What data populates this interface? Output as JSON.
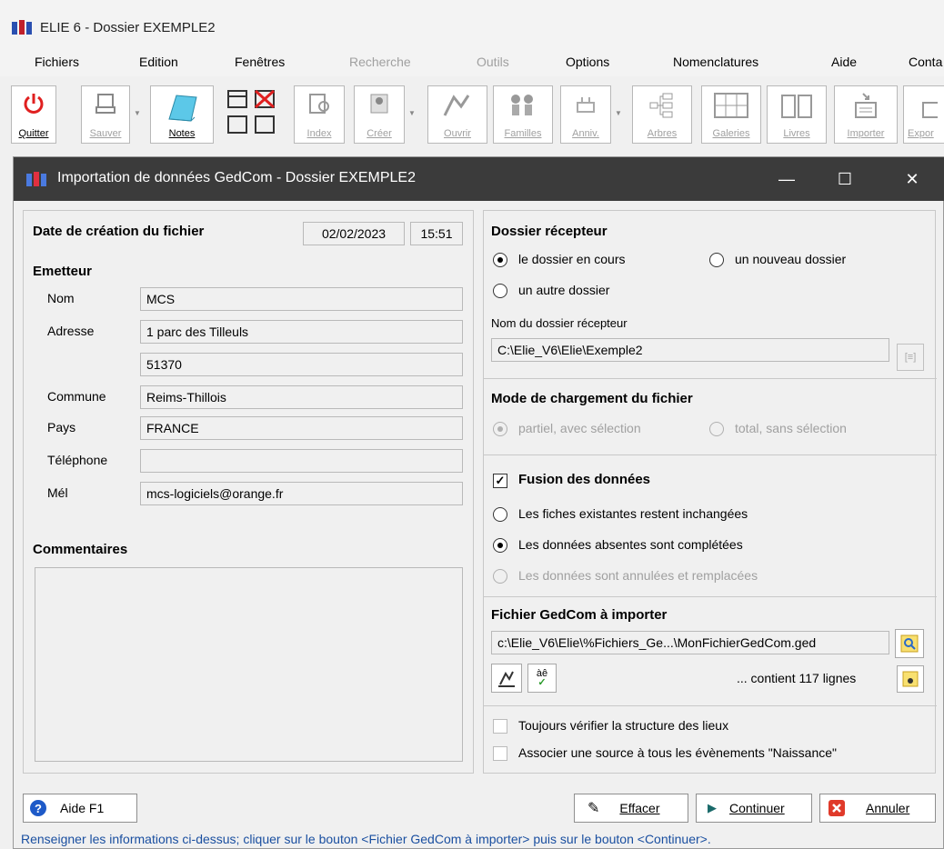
{
  "app": {
    "title": "ELIE 6 - Dossier  EXEMPLE2"
  },
  "menu": {
    "items": [
      {
        "label": "Fichiers"
      },
      {
        "label": "Edition"
      },
      {
        "label": "Fenêtres"
      },
      {
        "label": "Recherche"
      },
      {
        "label": "Outils"
      },
      {
        "label": "Options"
      },
      {
        "label": "Nomenclatures"
      },
      {
        "label": "Aide"
      },
      {
        "label": "Conta"
      }
    ]
  },
  "toolbar": {
    "quitter": "Quitter",
    "sauver": "Sauver",
    "notes": "Notes",
    "index": "Index",
    "creer": "Créer",
    "ouvrir": "Ouvrir",
    "familles": "Familles",
    "anniv": "Anniv.",
    "arbres": "Arbres",
    "galeries": "Galeries",
    "livres": "Livres",
    "importer": "Importer",
    "export": "Expor"
  },
  "dialog": {
    "title": "Importation de données GedCom - Dossier  EXEMPLE2",
    "creation": {
      "label": "Date de création du fichier",
      "date": "02/02/2023",
      "time": "15:51"
    },
    "emetteur": {
      "heading": "Emetteur",
      "nom_label": "Nom",
      "nom": "MCS",
      "adresse_label": "Adresse",
      "adresse1": "1 parc des Tilleuls",
      "adresse2": "51370",
      "commune_label": "Commune",
      "commune": "Reims-Thillois",
      "pays_label": "Pays",
      "pays": "FRANCE",
      "telephone_label": "Téléphone",
      "telephone": "",
      "mel_label": "Mél",
      "mel": "mcs-logiciels@orange.fr"
    },
    "commentaires": {
      "heading": "Commentaires",
      "value": ""
    },
    "recepteur": {
      "heading": "Dossier récepteur",
      "opt_courant": "le dossier en cours",
      "opt_nouveau": "un nouveau dossier",
      "opt_autre": "un autre dossier",
      "nom_label": "Nom du dossier récepteur",
      "nom_value": "C:\\Elie_V6\\Elie\\Exemple2"
    },
    "mode": {
      "heading": "Mode de chargement du fichier",
      "opt_partiel": "partiel, avec sélection",
      "opt_total": "total, sans sélection"
    },
    "fusion": {
      "label": "Fusion des données",
      "checked": true,
      "opt_inchangees": "Les fiches existantes restent inchangées",
      "opt_completees": "Les données absentes sont complétées",
      "opt_remplacees": "Les données sont annulées et remplacées"
    },
    "gedcom": {
      "heading": "Fichier GedCom à importer",
      "path": "c:\\Elie_V6\\Elie\\%Fichiers_Ge...\\MonFichierGedCom.ged",
      "lines": "... contient 117 lignes"
    },
    "options": {
      "verifier": "Toujours vérifier la structure des lieux",
      "associer": "Associer une source à tous les évènements \"Naissance\""
    },
    "buttons": {
      "aide": "Aide  F1",
      "effacer": "Effacer",
      "continuer": "Continuer",
      "annuler": "Annuler"
    },
    "status": "Renseigner les informations ci-dessus; cliquer sur le bouton <Fichier GedCom à importer> puis sur le bouton <Continuer>."
  },
  "colors": {
    "title_bar": "#3b3b3b",
    "status_text": "#1a4fa0",
    "quit_red": "#e02020"
  }
}
